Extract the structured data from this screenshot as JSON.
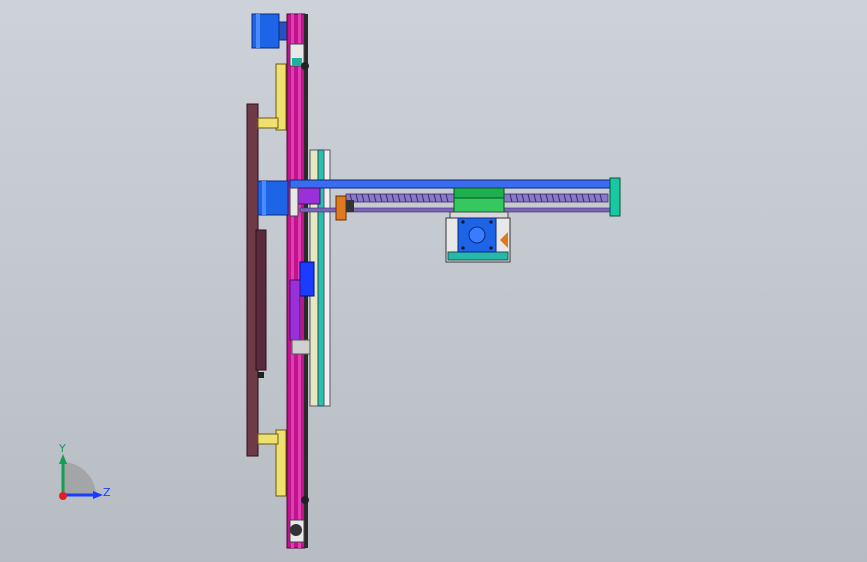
{
  "app": {
    "title": ""
  },
  "viewport": {
    "background_top": "#cdd2d8",
    "background_bottom": "#b7bcc3"
  },
  "model": {
    "description_visible": false,
    "colors": {
      "frame_magenta": "#c0148c",
      "rail_pink": "#e03cb4",
      "motor_blue": "#1e64e6",
      "beam_blue": "#3a6cf0",
      "plate_brown": "#6e3a48",
      "bracket_yellow": "#f0e070",
      "carriage_green": "#1cb050",
      "endcap_teal": "#18c8a0",
      "nut_orange": "#e07820",
      "screw_purple": "#7a66b8",
      "slider_violet": "#9a30d8"
    }
  },
  "triad": {
    "y_label": "Y",
    "z_label": "Z",
    "y_color": "#10a050",
    "z_color": "#1a3cff",
    "origin_color": "#e02020"
  }
}
